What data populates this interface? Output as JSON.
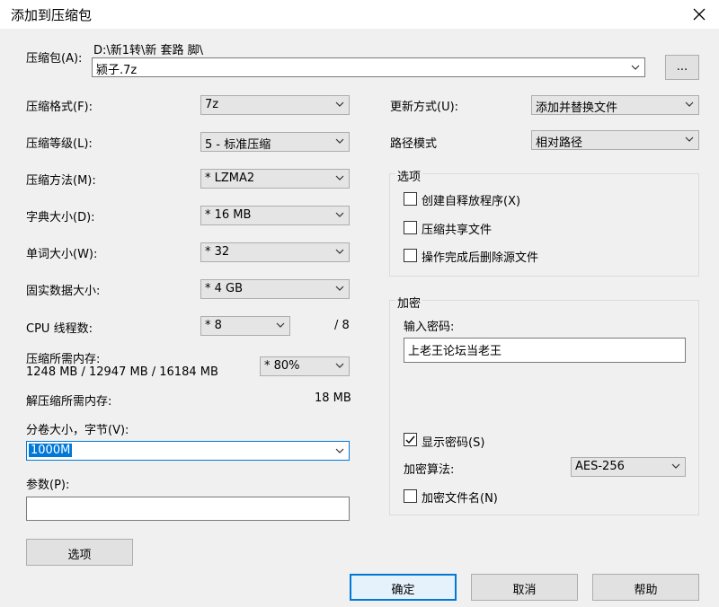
{
  "window": {
    "title": "添加到压缩包",
    "close_icon": "close-icon"
  },
  "archive": {
    "label": "压缩包(A):",
    "path": "D:\\新1转\\新 套路 脚\\",
    "filename": "颍子.7z",
    "browse_label": "..."
  },
  "left": {
    "format": {
      "label": "压缩格式(F):",
      "value": "7z"
    },
    "level": {
      "label": "压缩等级(L):",
      "value": "5 - 标准压缩"
    },
    "method": {
      "label": "压缩方法(M):",
      "value": "*  LZMA2"
    },
    "dict": {
      "label": "字典大小(D):",
      "value": "*  16 MB"
    },
    "word": {
      "label": "单词大小(W):",
      "value": "*  32"
    },
    "solid": {
      "label": "固实数据大小:",
      "value": "*  4 GB"
    },
    "threads": {
      "label": "CPU 线程数:",
      "value": "*  8",
      "total": "/ 8"
    },
    "memory": {
      "label": "压缩所需内存:",
      "detail": "1248 MB / 12947 MB / 16184 MB",
      "value": "*  80%"
    },
    "decompress": {
      "label": "解压缩所需内存:",
      "value": "18 MB"
    },
    "split": {
      "label": "分卷大小，字节(V):",
      "value": "1000M"
    },
    "params": {
      "label": "参数(P):",
      "value": ""
    },
    "options_button": "选项"
  },
  "right": {
    "update": {
      "label": "更新方式(U):",
      "value": "添加并替换文件"
    },
    "pathmode": {
      "label": "路径模式",
      "value": "相对路径"
    },
    "options_group": {
      "title": "选项",
      "items": [
        {
          "label": "创建自释放程序(X)",
          "checked": false
        },
        {
          "label": "压缩共享文件",
          "checked": false
        },
        {
          "label": "操作完成后删除源文件",
          "checked": false
        }
      ]
    },
    "encryption": {
      "title": "加密",
      "password_label": "输入密码:",
      "password": "上老王论坛当老王",
      "show_password": {
        "label": "显示密码(S)",
        "checked": true
      },
      "algo_label": "加密算法:",
      "algo_value": "AES-256",
      "encrypt_names": {
        "label": "加密文件名(N)",
        "checked": false
      }
    }
  },
  "buttons": {
    "ok": "确定",
    "cancel": "取消",
    "help": "帮助"
  }
}
